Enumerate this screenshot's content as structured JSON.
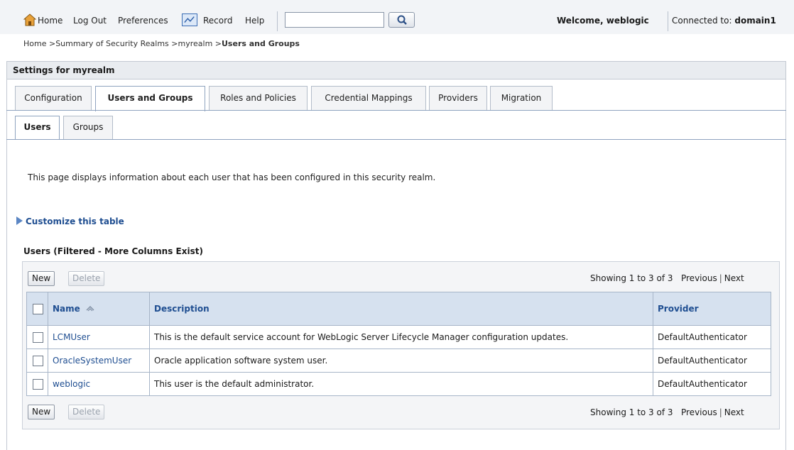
{
  "topbar": {
    "home": "Home",
    "logout": "Log Out",
    "preferences": "Preferences",
    "record": "Record",
    "help": "Help",
    "search_value": "",
    "welcome": "Welcome, weblogic",
    "connected_label": "Connected to:",
    "connected_domain": "domain1"
  },
  "breadcrumb": {
    "items": [
      "Home >",
      "Summary of Security Realms >",
      "myrealm >"
    ],
    "current": "Users and Groups"
  },
  "settings": {
    "title": "Settings for myrealm",
    "tabs": [
      "Configuration",
      "Users and Groups",
      "Roles and Policies",
      "Credential Mappings",
      "Providers",
      "Migration"
    ],
    "active_tab": "Users and Groups",
    "subtabs": [
      "Users",
      "Groups"
    ],
    "active_subtab": "Users"
  },
  "page": {
    "description": "This page displays information about each user that has been configured in this security realm.",
    "customize": "Customize this table",
    "table_title": "Users (Filtered - More Columns Exist)"
  },
  "table": {
    "new_label": "New",
    "delete_label": "Delete",
    "showing": "Showing 1 to 3 of 3",
    "previous": "Previous",
    "next": "Next",
    "columns": [
      "Name",
      "Description",
      "Provider"
    ],
    "rows": [
      {
        "name": "LCMUser",
        "description": "This is the default service account for WebLogic Server Lifecycle Manager configuration updates.",
        "provider": "DefaultAuthenticator"
      },
      {
        "name": "OracleSystemUser",
        "description": "Oracle application software system user.",
        "provider": "DefaultAuthenticator"
      },
      {
        "name": "weblogic",
        "description": "This user is the default administrator.",
        "provider": "DefaultAuthenticator"
      }
    ]
  },
  "colors": {
    "link": "#1f4e91",
    "header_bg": "#d6e1ef",
    "topbar_bg": "#f2f4f7"
  }
}
